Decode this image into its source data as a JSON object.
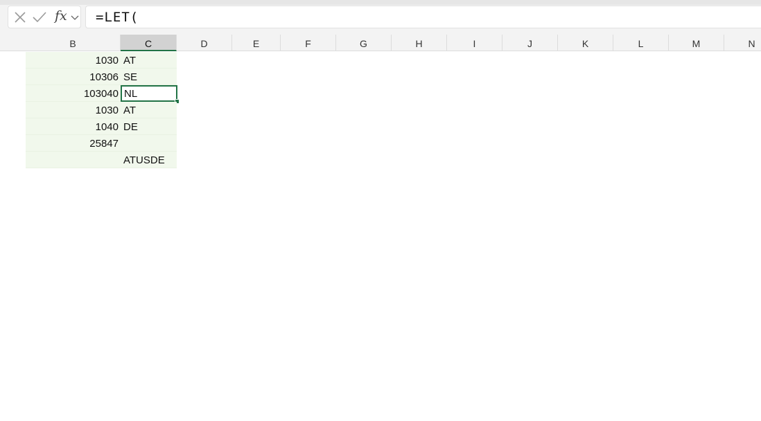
{
  "formula_bar": {
    "cancel_icon": "x-icon",
    "enter_icon": "check-icon",
    "fx_label": "fx",
    "dropdown_icon": "chevron-down-icon",
    "formula": "=LET("
  },
  "columns": [
    "B",
    "C",
    "D",
    "E",
    "F",
    "G",
    "H",
    "I",
    "J",
    "K",
    "L",
    "M",
    "N"
  ],
  "selected_column": "C",
  "rows": [
    {
      "b": "1030",
      "c": "AT"
    },
    {
      "b": "10306",
      "c": "SE"
    },
    {
      "b": "103040",
      "c": "NL"
    },
    {
      "b": "1030",
      "c": "AT"
    },
    {
      "b": "1040",
      "c": "DE"
    },
    {
      "b": "25847",
      "c": ""
    },
    {
      "b": "",
      "c": "ATUSDE"
    }
  ],
  "active_cell": {
    "column": "C",
    "row_index": 2
  },
  "colors": {
    "accent": "#217346",
    "range_fill": "#f1f8ec"
  }
}
